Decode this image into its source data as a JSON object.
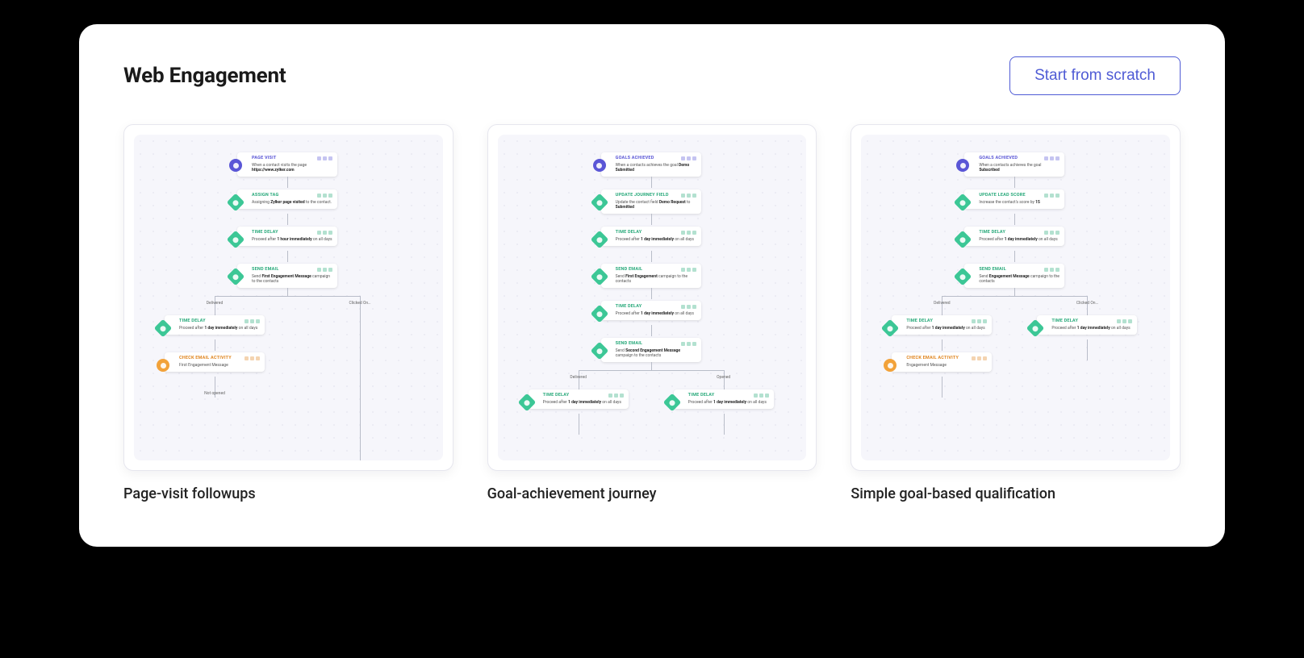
{
  "header": {
    "title": "Web Engagement",
    "scratch_button": "Start from scratch"
  },
  "templates": [
    {
      "label": "Page-visit followups",
      "branch_labels": {
        "left": "Delivered",
        "right": "Clicked On…"
      },
      "after_activity_label": "Not opened",
      "nodes": [
        {
          "kind": "purple",
          "title": "PAGE VISIT",
          "desc": "When a contact visits the page <b>https://www.zylker.com</b>"
        },
        {
          "kind": "green",
          "title": "ASSIGN TAG",
          "desc": "Assigning <b>Zylker page visited</b> to the contact."
        },
        {
          "kind": "green",
          "title": "TIME DELAY",
          "desc": "Proceed after <b>1 hour immediately</b> on all days"
        },
        {
          "kind": "green",
          "title": "SEND EMAIL",
          "desc": "Send <b>First Engagement Message</b> campaign to the contacts"
        },
        {
          "kind": "green",
          "title": "TIME DELAY",
          "desc": "Proceed after <b>1 day immediately</b> on all days",
          "branch": "left"
        },
        {
          "kind": "orange",
          "title": "CHECK EMAIL ACTIVITY",
          "desc": "First Engagement Message",
          "branch": "left"
        }
      ]
    },
    {
      "label": "Goal-achievement journey",
      "branch_labels": {
        "left": "Delivered",
        "right": "Opened"
      },
      "nodes": [
        {
          "kind": "purple",
          "title": "GOALS ACHIEVED",
          "desc": "When a contacts achieves the goal <b>Demo Submitted</b>"
        },
        {
          "kind": "green",
          "title": "UPDATE JOURNEY FIELD",
          "desc": "Update the contact field <b>Demo Request</b> to <b>Submitted</b>"
        },
        {
          "kind": "green",
          "title": "TIME DELAY",
          "desc": "Proceed after <b>1 day immediately</b> on all days"
        },
        {
          "kind": "green",
          "title": "SEND EMAIL",
          "desc": "Send <b>First Engagement</b> campaign to the contacts"
        },
        {
          "kind": "green",
          "title": "TIME DELAY",
          "desc": "Proceed after <b>1 day immediately</b> on all days"
        },
        {
          "kind": "green",
          "title": "SEND EMAIL",
          "desc": "Send <b>Second Engagement Message</b> campaign to the contacts"
        },
        {
          "kind": "green",
          "title": "TIME DELAY",
          "desc": "Proceed after <b>1 day immediately</b> on all days",
          "branch": "left"
        },
        {
          "kind": "green",
          "title": "TIME DELAY",
          "desc": "Proceed after <b>1 day immediately</b> on all days",
          "branch": "right"
        }
      ]
    },
    {
      "label": "Simple goal-based qualification",
      "branch_labels": {
        "left": "Delivered",
        "right": "Clicked On…"
      },
      "nodes": [
        {
          "kind": "purple",
          "title": "GOALS ACHIEVED",
          "desc": "When a contacts achieves the goal <b>Subscribed</b>"
        },
        {
          "kind": "green",
          "title": "UPDATE LEAD SCORE",
          "desc": "Increase the contact's score by <b>15</b>"
        },
        {
          "kind": "green",
          "title": "TIME DELAY",
          "desc": "Proceed after <b>1 day immediately</b> on all days"
        },
        {
          "kind": "green",
          "title": "SEND EMAIL",
          "desc": "Send <b>Engagement Message</b> campaign to the contacts"
        },
        {
          "kind": "green",
          "title": "TIME DELAY",
          "desc": "Proceed after <b>1 day immediately</b> on all days",
          "branch": "left"
        },
        {
          "kind": "green",
          "title": "TIME DELAY",
          "desc": "Proceed after <b>1 day immediately</b> on all days",
          "branch": "right"
        },
        {
          "kind": "orange",
          "title": "CHECK EMAIL ACTIVITY",
          "desc": "Engagement Message",
          "branch": "left"
        }
      ]
    }
  ]
}
